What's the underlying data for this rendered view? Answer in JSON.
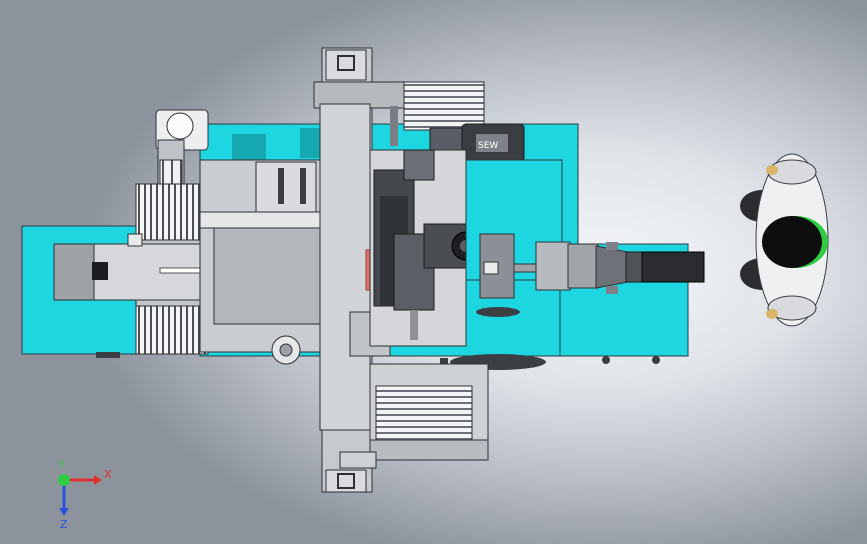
{
  "motor_label": "SEW",
  "axes": {
    "x": "X",
    "y": "Y",
    "z": "Z"
  },
  "colors": {
    "cyan": "#1ed6e0",
    "grey_light": "#d2d5d8",
    "grey_mid": "#a9adb2",
    "grey_dark": "#3a3d42",
    "x_axis": "#e0322a",
    "y_axis": "#2ecc40",
    "z_axis": "#2a54e0"
  }
}
